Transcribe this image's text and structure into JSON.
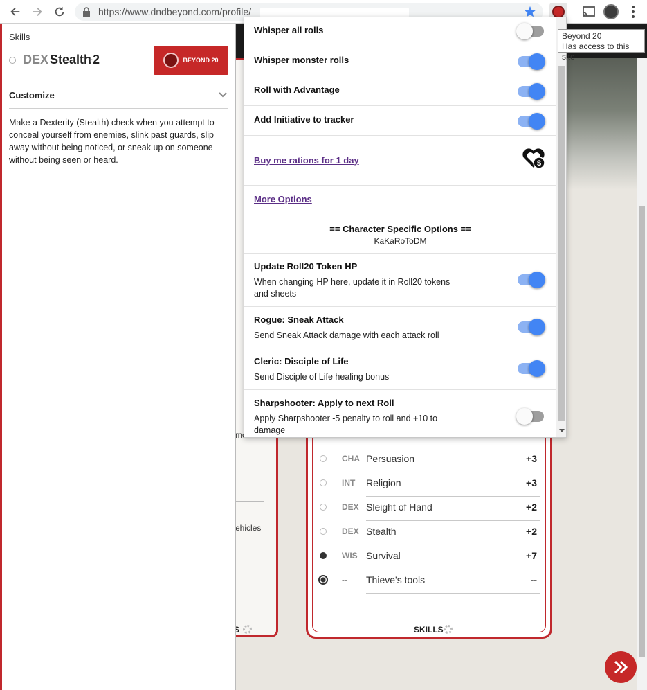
{
  "browser": {
    "url": "https://www.dndbeyond.com/profile/",
    "tooltip_title": "Beyond 20",
    "tooltip_subtitle": "Has access to this site"
  },
  "sidebar": {
    "section_label": "Skills",
    "skill_stat": "DEX",
    "skill_name": "Stealth",
    "skill_bonus_sign": "+",
    "skill_bonus_value": "2",
    "beyond20_button": "BEYOND 20",
    "customize_label": "Customize",
    "description": "Make a Dexterity (Stealth) check when you attempt to conceal yourself from enemies, slink past guards, slip away without being noticed, or sneak up on someone without being seen or heard."
  },
  "popup": {
    "options": [
      {
        "title": "Whisper all rolls",
        "enabled": false
      },
      {
        "title": "Whisper monster rolls",
        "enabled": true
      },
      {
        "title": "Roll with Advantage",
        "enabled": true
      },
      {
        "title": "Add Initiative to tracker",
        "enabled": true
      }
    ],
    "donate_link": "Buy me rations for 1 day",
    "more_options_link": "More Options",
    "character_section_title": "== Character Specific Options ==",
    "character_name": "KaKaRoToDM",
    "character_options": [
      {
        "title": "Update Roll20 Token HP",
        "description": "When changing HP here, update it in Roll20 tokens and sheets",
        "enabled": true
      },
      {
        "title": "Rogue: Sneak Attack",
        "description": "Send Sneak Attack damage with each attack roll",
        "enabled": true
      },
      {
        "title": "Cleric: Disciple of Life",
        "description": "Send Disciple of Life healing bonus",
        "enabled": true
      },
      {
        "title": "Sharpshooter: Apply to next Roll",
        "description": "Apply Sharpshooter -5 penalty to roll and +10 to damage",
        "enabled": false
      }
    ]
  },
  "skills_list": {
    "rows": [
      {
        "stat": "CHA",
        "name": "Persuasion",
        "bonus": "+3",
        "proficiency": "none"
      },
      {
        "stat": "INT",
        "name": "Religion",
        "bonus": "+3",
        "proficiency": "none"
      },
      {
        "stat": "DEX",
        "name": "Sleight of Hand",
        "bonus": "+2",
        "proficiency": "none"
      },
      {
        "stat": "DEX",
        "name": "Stealth",
        "bonus": "+2",
        "proficiency": "none"
      },
      {
        "stat": "WIS",
        "name": "Survival",
        "bonus": "+7",
        "proficiency": "proficient"
      },
      {
        "stat": "--",
        "name": "Thieve's tools",
        "bonus": "--",
        "proficiency": "expertise"
      }
    ],
    "footer": "SKILLS",
    "left_panel_footer": "S",
    "left_panel_fragments": [
      "mo",
      "ehicles"
    ]
  },
  "colors": {
    "accent_red": "#c62828",
    "toggle_on": "#4285f4",
    "link_purple": "#5b2e86"
  }
}
